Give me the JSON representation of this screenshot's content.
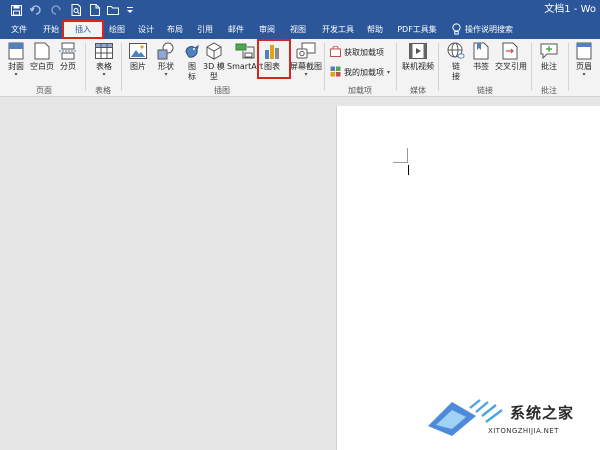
{
  "title_bar": {
    "document_title": "文档1 - Wo"
  },
  "tabs": [
    {
      "label": "文件"
    },
    {
      "label": "开始"
    },
    {
      "label": "插入",
      "active": true
    },
    {
      "label": "绘图"
    },
    {
      "label": "设计"
    },
    {
      "label": "布局"
    },
    {
      "label": "引用"
    },
    {
      "label": "邮件"
    },
    {
      "label": "审阅"
    },
    {
      "label": "视图"
    },
    {
      "label": "开发工具"
    },
    {
      "label": "帮助"
    },
    {
      "label": "PDF工具集"
    }
  ],
  "tell_me": "操作说明搜索",
  "ribbon": {
    "pages": {
      "cover": "封面",
      "blank": "空白页",
      "break": "分页",
      "group": "页面"
    },
    "tables": {
      "table": "表格",
      "group": "表格"
    },
    "illustrations": {
      "pictures": "图片",
      "shapes": "形状",
      "icons": "图\n标",
      "models_3d": "3D 模\n型",
      "smartart": "SmartArt",
      "chart": "图表",
      "screenshot": "屏幕截图",
      "group": "插图"
    },
    "addins": {
      "get": "获取加载项",
      "mine": "我的加载项",
      "group": "加载项"
    },
    "media": {
      "online_video": "联机视频",
      "group": "媒体"
    },
    "links": {
      "link": "链\n接",
      "bookmark": "书签",
      "cross_ref": "交叉引用",
      "group": "链接"
    },
    "comments": {
      "comment": "批注",
      "group": "批注"
    },
    "header_footer": {
      "header": "页眉"
    }
  },
  "watermark": {
    "logo_text": "系统之家",
    "url": "XITONGZHIJIA.NET"
  },
  "colors": {
    "accent": "#2b579a",
    "highlight": "#d9261c",
    "ribbon_bg": "#f3f3f3",
    "canvas_bg": "#e6e6e6"
  }
}
